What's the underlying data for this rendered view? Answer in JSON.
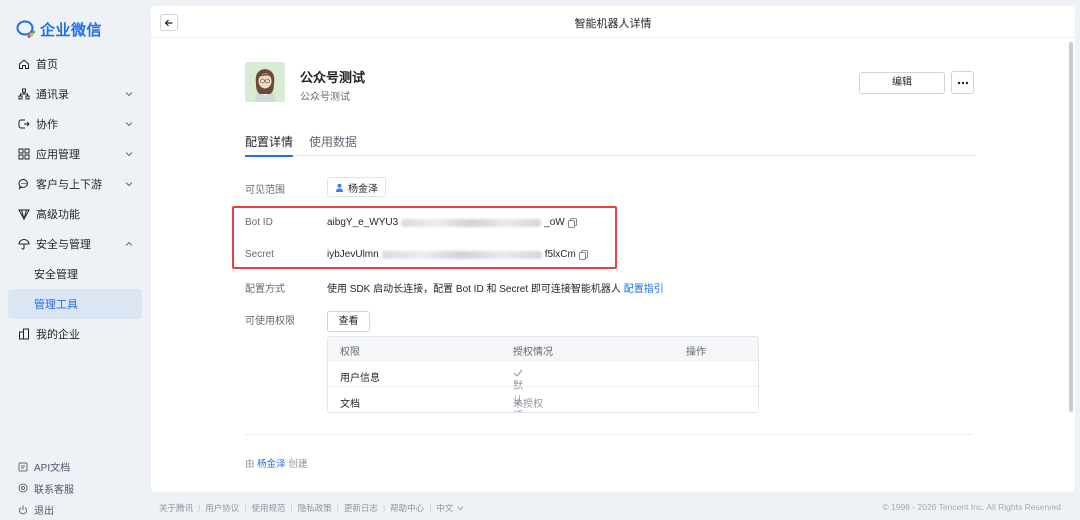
{
  "sidebar": {
    "logo_text": "企业微信",
    "items": [
      {
        "label": "首页",
        "icon": "home-icon",
        "has_chevron": false
      },
      {
        "label": "通讯录",
        "icon": "org-icon",
        "has_chevron": true
      },
      {
        "label": "协作",
        "icon": "collab-icon",
        "has_chevron": true
      },
      {
        "label": "应用管理",
        "icon": "apps-icon",
        "has_chevron": true
      },
      {
        "label": "客户与上下游",
        "icon": "chat-icon",
        "has_chevron": true
      },
      {
        "label": "高级功能",
        "icon": "diamond-icon",
        "has_chevron": false
      },
      {
        "label": "安全与管理",
        "icon": "umbrella-icon",
        "has_chevron": true
      },
      {
        "label": "安全管理",
        "sub": true
      },
      {
        "label": "管理工具",
        "sub": true,
        "active": true
      },
      {
        "label": "我的企业",
        "icon": "building-icon",
        "has_chevron": false
      }
    ],
    "bottom": [
      {
        "label": "API文档",
        "icon": "doc-icon"
      },
      {
        "label": "联系客服",
        "icon": "support-icon"
      },
      {
        "label": "退出",
        "icon": "power-icon"
      }
    ]
  },
  "header": {
    "title": "智能机器人详情"
  },
  "bot": {
    "name": "公众号测试",
    "description": "公众号测试",
    "edit_label": "编辑"
  },
  "tabs": [
    {
      "label": "配置详情",
      "active": true
    },
    {
      "label": "使用数据",
      "active": false
    }
  ],
  "details": {
    "scope_label": "可见范围",
    "scope_user": "杨金泽",
    "botid_label": "Bot ID",
    "botid_prefix": "aibgY_e_WYU3",
    "botid_suffix": "_oW",
    "secret_label": "Secret",
    "secret_prefix": "iybJevUlmn",
    "secret_suffix": "f5lxCm",
    "method_label": "配置方式",
    "method_text": "使用 SDK 启动长连接，配置 Bot ID 和 Secret 即可连接智能机器人",
    "method_link": "配置指引",
    "perm_label": "可使用权限",
    "view_label": "查看"
  },
  "permissions": {
    "headers": [
      "权限",
      "授权情况",
      "操作"
    ],
    "rows": [
      {
        "name": "用户信息",
        "status": "默认授权",
        "granted": true
      },
      {
        "name": "文档",
        "status": "未授权",
        "granted": false
      }
    ]
  },
  "creator": {
    "prefix": "由",
    "name": "杨金泽",
    "suffix": "创建"
  },
  "footer": {
    "links": [
      "关于腾讯",
      "用户协议",
      "使用规范",
      "隐私政策",
      "更新日志",
      "帮助中心",
      "中文"
    ],
    "copyright": "© 1998 - 2026 Tencent Inc. All Rights Reserved"
  },
  "colors": {
    "accent": "#1f6fe5",
    "highlight": "#e34242"
  }
}
